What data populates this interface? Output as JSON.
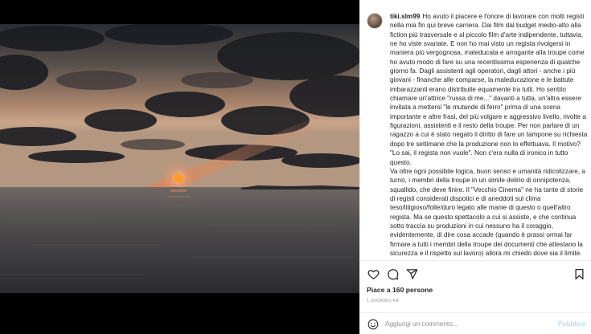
{
  "post": {
    "username": "tiki.slm99",
    "caption": "Ho avuto il piacere e l'onore di lavorare con molti registi nella mia fin qui breve carriera. Dai film dal budget medio-alto alla fiction più trasversale e al piccolo film d'arte indipendente, tuttavia, ne ho viste svariate. E non ho mai visto un regista rivolgersi in maniera più vergognosa, maleducata e arrogante alla troupe come ho avuto modo di fare su una recentissima esperienza di qualche giorno fa. Dagli assistenti agli operatori, dagli attori - anche i più giovani - finanche alle comparse, la maleducazione e le battute imbarazzanti erano distribuite equamente tra tutti. Ho sentito chiamare un'attrice \"russa di me...\" davanti a tutta, un'altra essere invitata a mettersi \"le mutande di ferro\" prima di una scena importante e altre frasi, del più volgare e aggressivo livello, rivolte a figurazioni, assistenti e il resto della troupe. Per non parlare di un ragazzo a cui è stato negato il diritto di fare un tampone su richiesta dopo tre settimane che la produzione non lo effettuava. Il motivo? \"Lo sai, il regista non vuole\". Non c'era nulla di ironico in tutto questo.",
    "caption_2": "Va oltre ogni possibile logica, buon senso e umanità ridicolizzare, a turno, i membri della troupe in un simile delirio di onnipotenza, squallido, che deve finire. Il \"Vecchio Cinema\" ne ha tante di storie di registi considerati dispotici e di aneddoti sul clima teso/litigioso/folle/duro legato alle manie di questo o quell'altro regista. Ma se questo spettacolo a cui si assiste, e che continua sotto traccia su produzioni in cui nessuno ha il coraggio, evidentemente, di dire cosa accade (quando è prassi ormai far firmare a tutti i membri della troupe dei documenti che attestano la sicurezza e il rispetto sul lavoro) allora mi chiedo dove sia il limite.",
    "likes": "Piace a 160 persone",
    "date": "1 giorno fa"
  },
  "actions": {
    "like": "heart-icon",
    "comment": "comment-icon",
    "share": "share-icon",
    "save": "bookmark-icon"
  },
  "comment_box": {
    "placeholder": "Aggiungi un commento...",
    "publish_label": "Pubblica"
  },
  "colors": {
    "publish_disabled": "#b2dffc",
    "meta_gray": "#8e8e8e",
    "text": "#262626"
  }
}
